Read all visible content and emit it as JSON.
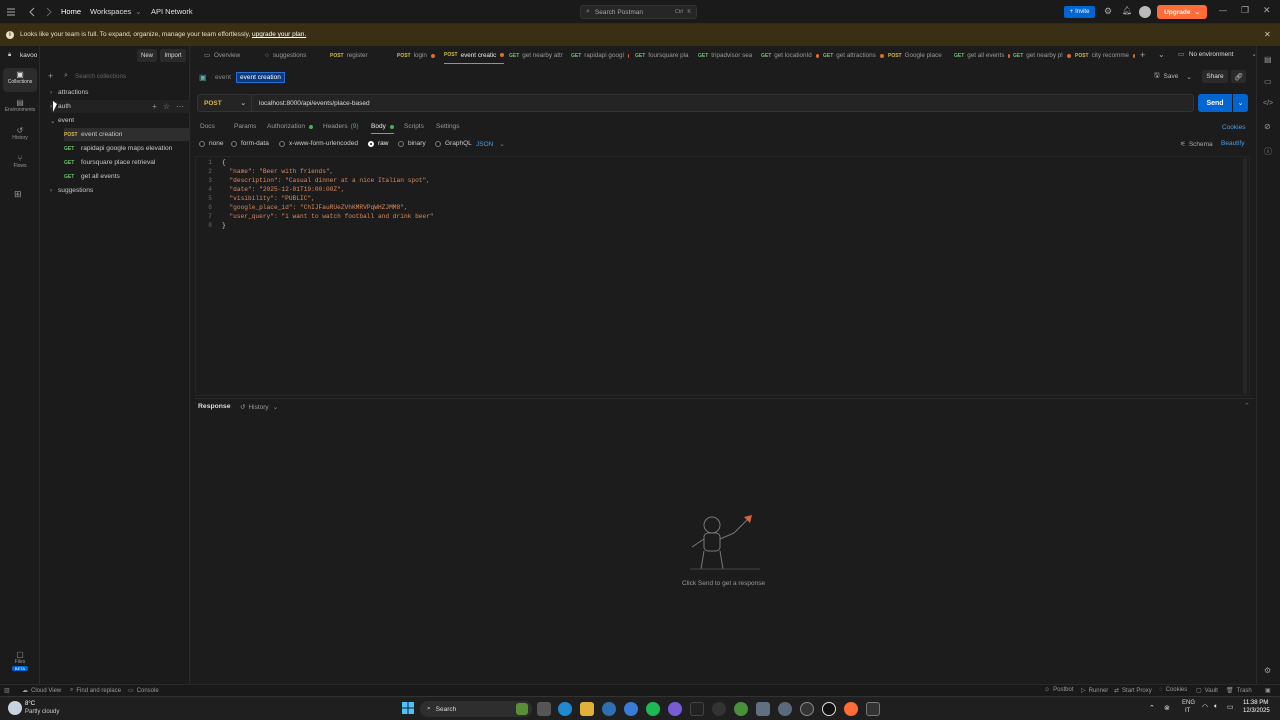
{
  "topbar": {
    "home": "Home",
    "workspaces": "Workspaces",
    "api_network": "API Network",
    "search_placeholder": "Search Postman",
    "shortcut_ctrl": "Ctrl",
    "shortcut_k": "K",
    "invite": "Invite",
    "upgrade": "Upgrade"
  },
  "banner": {
    "text": "Looks like your team is full. To expand, organize, manage your team effortlessly,",
    "link": "upgrade your plan."
  },
  "rail": {
    "collections": "Collections",
    "environments": "Environments",
    "history": "History",
    "flows": "Flows",
    "files": "Files",
    "beta": "BETA"
  },
  "workspace": {
    "name": "kavoo",
    "new": "New",
    "import": "Import",
    "search_placeholder": "Search collections"
  },
  "tree": {
    "attractions": "attractions",
    "auth": "auth",
    "event": "event",
    "suggestions": "suggestions",
    "requests": [
      {
        "method": "POST",
        "name": "event creation"
      },
      {
        "method": "GET",
        "name": "rapidapi google maps elevation"
      },
      {
        "method": "GET",
        "name": "foursquare place retrieval"
      },
      {
        "method": "GET",
        "name": "get all events"
      }
    ]
  },
  "tabs": [
    {
      "method": "",
      "label": "Overview",
      "dot": false
    },
    {
      "method": "",
      "label": "suggestions",
      "dot": false
    },
    {
      "method": "POST",
      "label": "register",
      "dot": false
    },
    {
      "method": "POST",
      "label": "login",
      "dot": true
    },
    {
      "method": "POST",
      "label": "event creatic",
      "dot": true
    },
    {
      "method": "GET",
      "label": "get nearby attr",
      "dot": true
    },
    {
      "method": "GET",
      "label": "rapidapi googl",
      "dot": true
    },
    {
      "method": "GET",
      "label": "foursquare pla",
      "dot": false
    },
    {
      "method": "GET",
      "label": "tripadvisor sea",
      "dot": false
    },
    {
      "method": "GET",
      "label": "get locationId",
      "dot": true
    },
    {
      "method": "GET",
      "label": "get attractions",
      "dot": true
    },
    {
      "method": "POST",
      "label": "Google place",
      "dot": false
    },
    {
      "method": "GET",
      "label": "get all events",
      "dot": true
    },
    {
      "method": "GET",
      "label": "get nearby pl",
      "dot": true
    },
    {
      "method": "POST",
      "label": "city recomme",
      "dot": true
    }
  ],
  "env": {
    "label": "No environment"
  },
  "request": {
    "breadcrumb_parent": "event",
    "breadcrumb_current": "event creation",
    "save": "Save",
    "share": "Share",
    "method": "POST",
    "url": "localhost:8000/api/events/place-based",
    "send": "Send"
  },
  "subtabs": {
    "docs": "Docs",
    "params": "Params",
    "authorization": "Authorization",
    "headers": "Headers",
    "headers_count": "(9)",
    "body": "Body",
    "scripts": "Scripts",
    "settings": "Settings",
    "cookies": "Cookies"
  },
  "body_modes": {
    "none": "none",
    "form_data": "form-data",
    "urlencoded": "x-www-form-urlencoded",
    "raw": "raw",
    "binary": "binary",
    "graphql": "GraphQL",
    "json": "JSON",
    "schema": "Schema",
    "beautify": "Beautify"
  },
  "code": {
    "lines": [
      "{",
      "  \"name\": \"Beer with friends\",",
      "  \"description\": \"Casual dinner at a nice Italian spot\",",
      "  \"date\": \"2025-12-01T19:00:00Z\",",
      "  \"visibility\": \"PUBLIC\",",
      "  \"google_place_id\": \"ChIJFauRUeZVhKMRVPqWHZJMM8\",",
      "  \"user_query\": \"i want to watch football and drink beer\"",
      "}"
    ],
    "line_numbers": [
      "1",
      "2",
      "3",
      "4",
      "5",
      "6",
      "7",
      "8"
    ]
  },
  "response": {
    "title": "Response",
    "history": "History",
    "empty_text": "Click Send to get a response"
  },
  "statusbar": {
    "cloud_view": "Cloud View",
    "find_replace": "Find and replace",
    "console": "Console",
    "postbot": "Postbot",
    "runner": "Runner",
    "start_proxy": "Start Proxy",
    "cookies": "Cookies",
    "vault": "Vault",
    "trash": "Trash"
  },
  "taskbar": {
    "temp": "8°C",
    "weather": "Partly cloudy",
    "search": "Search",
    "lang1": "ENG",
    "lang2": "IT",
    "time": "11:38 PM",
    "date": "12/3/2025"
  },
  "colors": {
    "accent": "#ff6c37",
    "send": "#0265d2",
    "banner_bg": "#382f14"
  }
}
